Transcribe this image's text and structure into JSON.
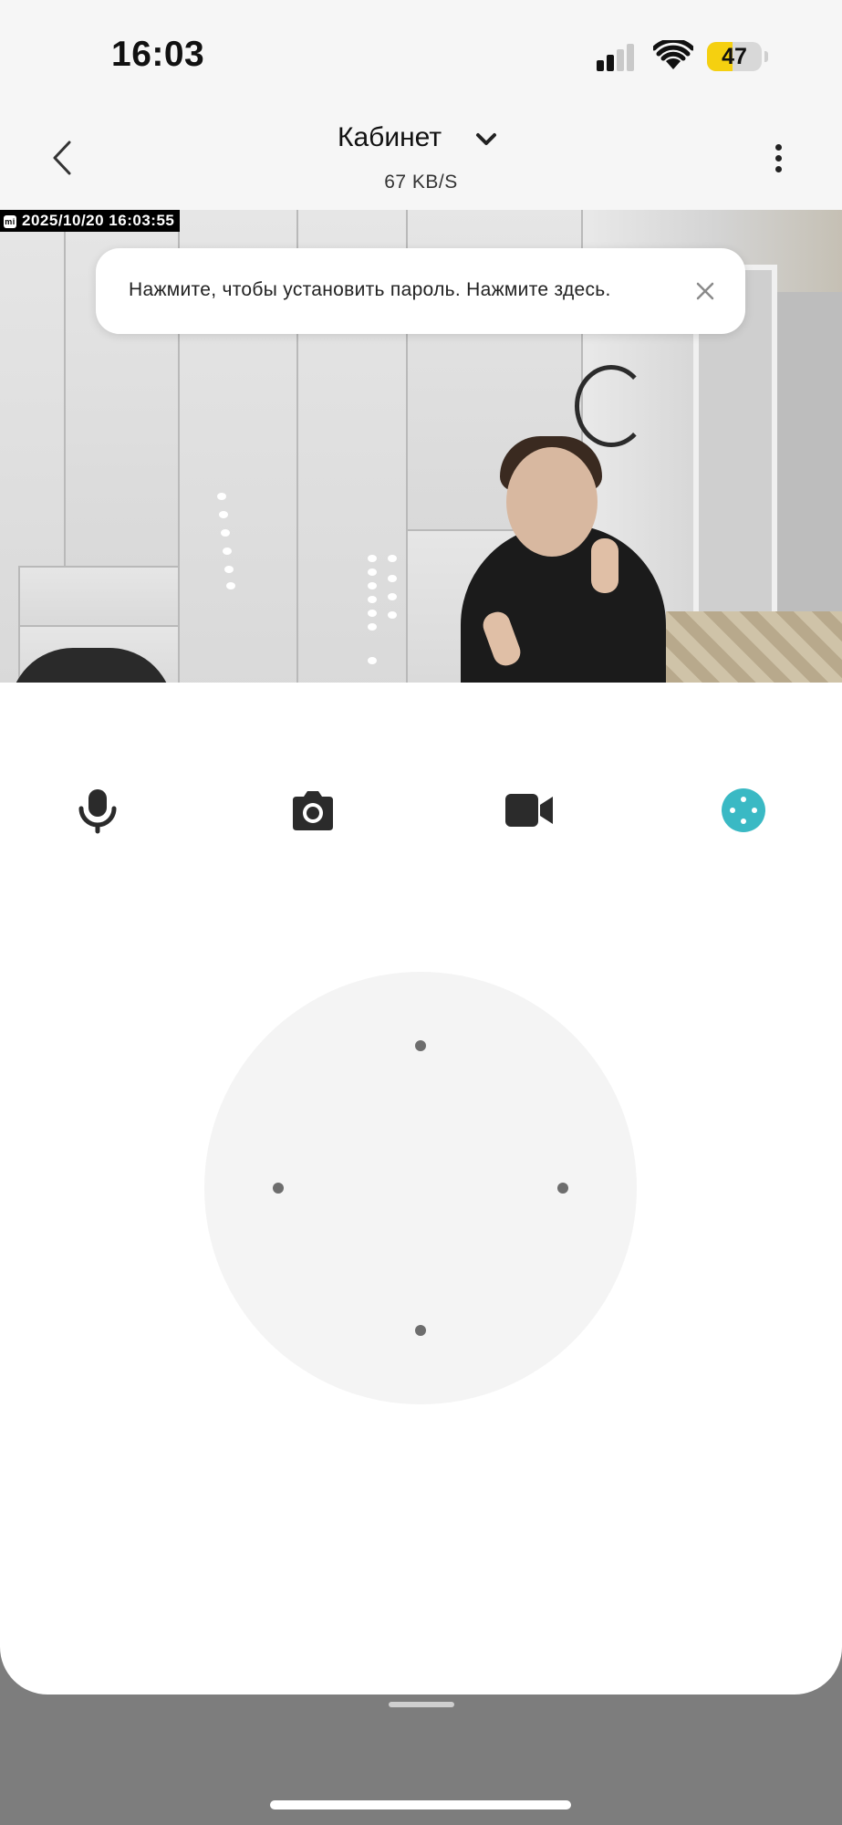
{
  "status_bar": {
    "time": "16:03",
    "battery_level": "47"
  },
  "header": {
    "title": "Кабинет",
    "bitrate": "67 KB/S"
  },
  "video": {
    "timestamp": "2025/10/20  16:03:55",
    "watermark": "mi"
  },
  "toast": {
    "message": "Нажмите, чтобы установить пароль. Нажмите здесь."
  },
  "controls": {
    "items": [
      {
        "icon": "microphone-icon"
      },
      {
        "icon": "camera-icon"
      },
      {
        "icon": "video-camera-icon"
      },
      {
        "icon": "pan-tilt-control-icon",
        "active": true
      }
    ]
  },
  "colors": {
    "accent": "#3ab9c4",
    "battery": "#f5d010",
    "icon_dark": "#2b2b2b"
  }
}
